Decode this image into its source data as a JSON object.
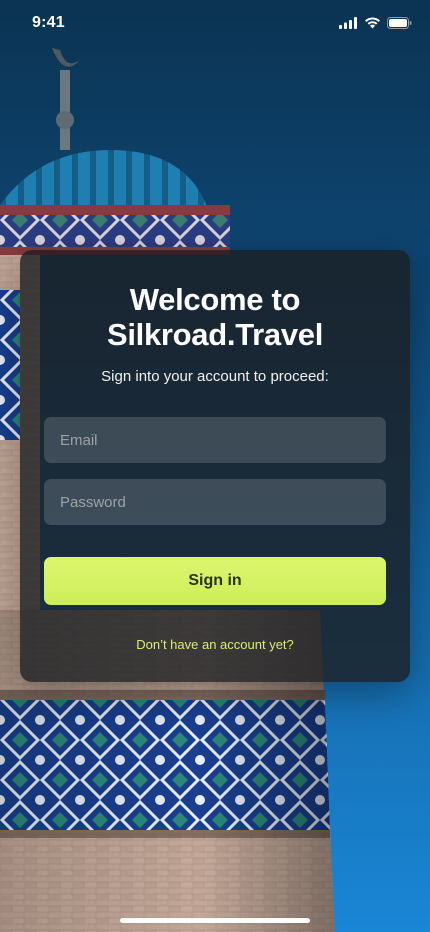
{
  "status_bar": {
    "time": "9:41",
    "icons": [
      "signal-icon",
      "wifi-icon",
      "battery-icon"
    ]
  },
  "login": {
    "title_line1": "Welcome to",
    "title_line2": "Silkroad.Travel",
    "subtitle": "Sign into your account to proceed:",
    "email_placeholder": "Email",
    "password_placeholder": "Password",
    "signin_label": "Sign in",
    "signup_link": "Don’t have an account yet?"
  },
  "colors": {
    "accent": "#d4f264",
    "link": "#d7ef72",
    "card": "#1c1e22",
    "sky_top": "#0b3352",
    "sky_bottom": "#1a86d6"
  }
}
